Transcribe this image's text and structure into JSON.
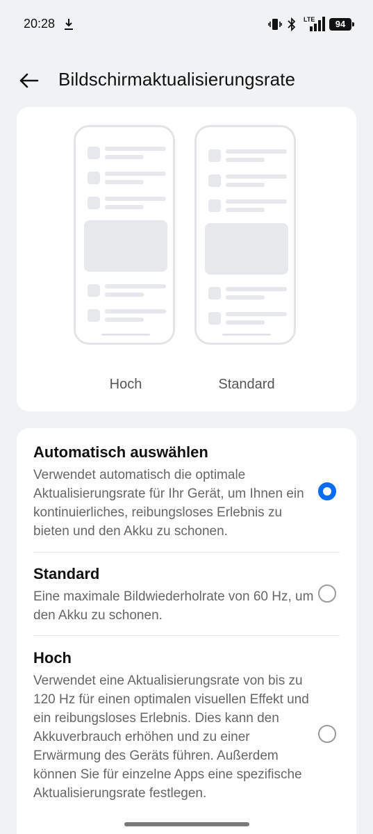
{
  "status": {
    "time": "20:28",
    "battery": "94",
    "lte_label": "LTE"
  },
  "header": {
    "title": "Bildschirmaktualisierungsrate"
  },
  "preview": {
    "labels": [
      "Hoch",
      "Standard"
    ]
  },
  "options": [
    {
      "title": "Automatisch auswählen",
      "description": "Verwendet automatisch die optimale Aktualisierungsrate für Ihr Gerät, um Ihnen ein kontinuierliches, reibungsloses Erlebnis zu bieten und den Akku zu schonen.",
      "selected": true
    },
    {
      "title": "Standard",
      "description": "Eine maximale Bildwiederholrate von 60 Hz, um den Akku zu schonen.",
      "selected": false
    },
    {
      "title": "Hoch",
      "description": "Verwendet eine Aktualisierungsrate von bis zu 120 Hz für einen optimalen visuellen Effekt und ein reibungsloses Erlebnis. Dies kann den Akkuverbrauch erhöhen und zu einer Erwärmung des Geräts führen. Außerdem können Sie für einzelne Apps eine spezifische Aktualisierungsrate festlegen.",
      "selected": false
    }
  ],
  "colors": {
    "accent": "#0a6cf0",
    "background": "#f1f2f4",
    "card": "#ffffff"
  }
}
